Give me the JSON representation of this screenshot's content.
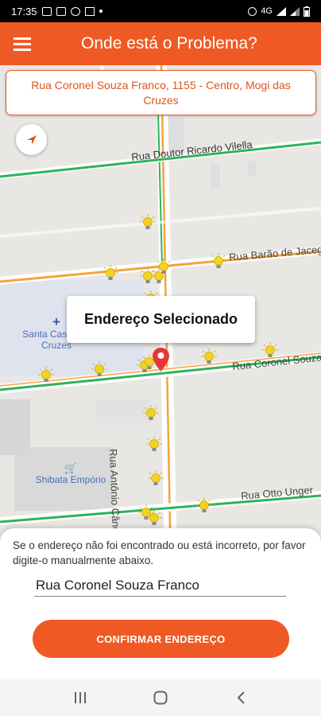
{
  "status_bar": {
    "time": "17:35",
    "right_text": "4G"
  },
  "app_bar": {
    "title": "Onde está o Problema?",
    "menu_icon": "hamburger-menu-icon"
  },
  "address_banner": {
    "text": "Rua Coronel Souza Franco, 1155 - Centro, Mogi das Cruzes"
  },
  "map": {
    "streets": [
      "Rua Doutor Ricardo Vilella",
      "Rua Barão de Jaceguai",
      "Rua Coronel Souza Franco",
      "Rua Antônio Cândido de Alvarenga",
      "Rua Otto Unger"
    ],
    "places": [
      "Santa Casa das Cruzes",
      "Shibata Empório"
    ],
    "popup_label": "Endereço Selecionado",
    "colors": {
      "street_green": "#2db35b",
      "street_orange": "#f6a23c",
      "marker": "#f2d321",
      "pin": "#e53935"
    }
  },
  "bottom_sheet": {
    "hint": "Se o endereço não foi encontrado ou está incorreto, por favor digite-o manualmente abaixo.",
    "address_value": "Rua Coronel Souza Franco",
    "confirm_label": "CONFIRMAR ENDEREÇO"
  },
  "theme": {
    "accent": "#ef5a24"
  }
}
